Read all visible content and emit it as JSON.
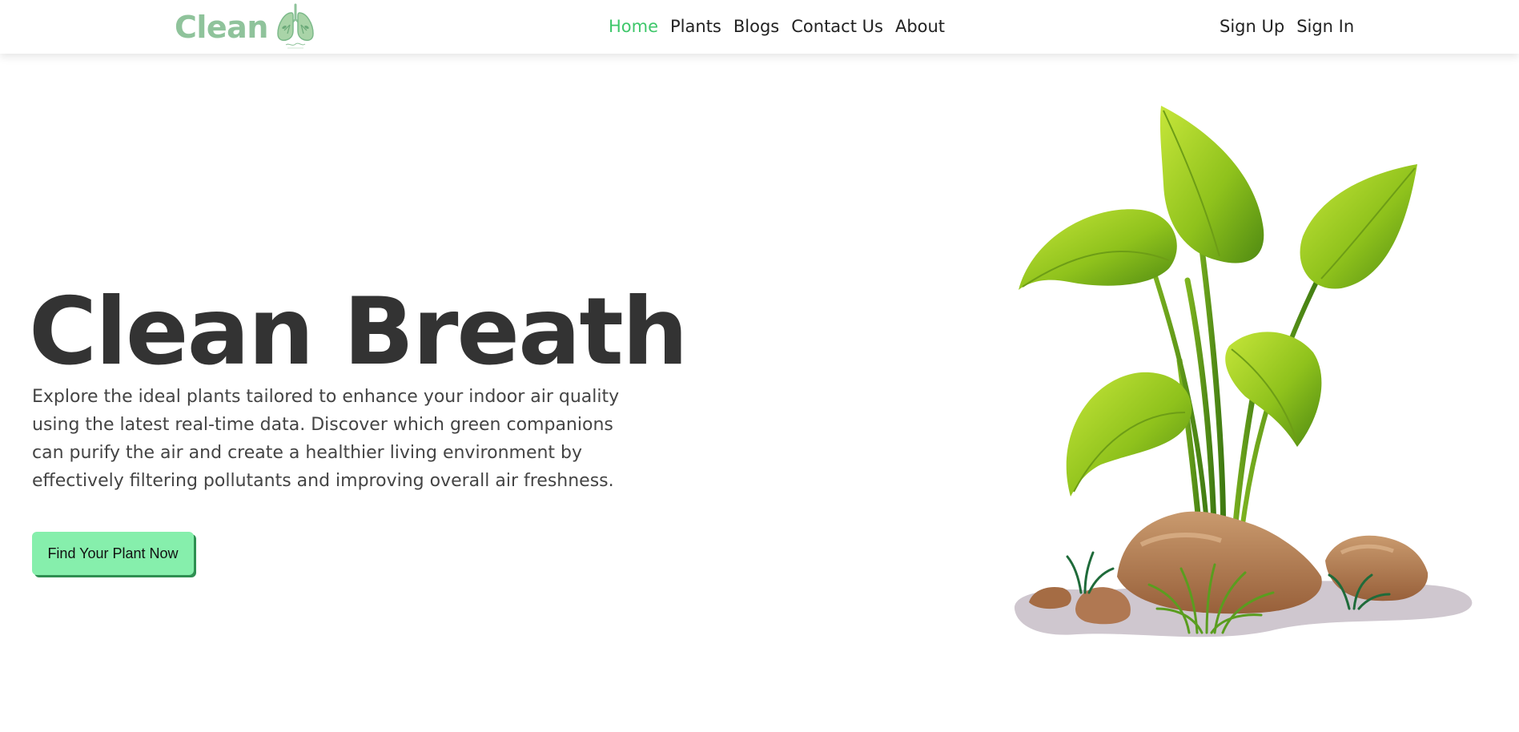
{
  "header": {
    "logo_text": "Clean",
    "logo_icon": "lungs-icon",
    "nav": [
      {
        "label": "Home",
        "active": true
      },
      {
        "label": "Plants",
        "active": false
      },
      {
        "label": "Blogs",
        "active": false
      },
      {
        "label": "Contact Us",
        "active": false
      },
      {
        "label": "About",
        "active": false
      }
    ],
    "auth": {
      "sign_up": "Sign Up",
      "sign_in": "Sign In"
    }
  },
  "hero": {
    "title": "Clean Breath",
    "description": "Explore the ideal plants tailored to enhance your indoor air quality using the latest real-time data. Discover which green companions can purify the air and create a healthier living environment by effectively filtering pollutants and improving overall air freshness.",
    "cta_label": "Find Your Plant Now",
    "illustration": "plant-on-rocks-illustration"
  },
  "colors": {
    "brand": "#8fc39b",
    "nav_active": "#3ec76a",
    "cta_bg": "#86efac",
    "cta_shadow": "#2e8f51",
    "title_text": "#333333"
  }
}
